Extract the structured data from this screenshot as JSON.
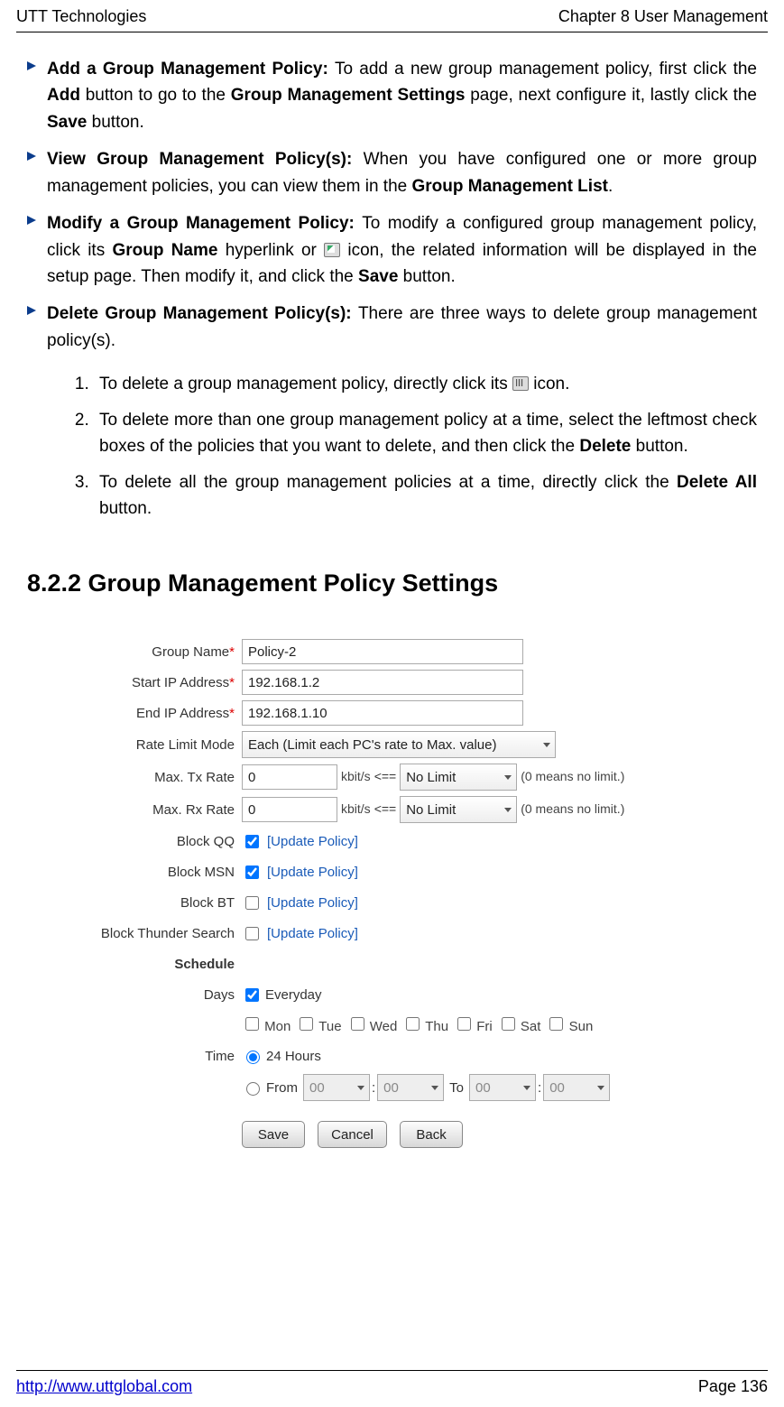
{
  "header": {
    "left": "UTT Technologies",
    "right": "Chapter 8 User Management"
  },
  "footer": {
    "url": "http://www.uttglobal.com",
    "page": "Page 136"
  },
  "bullets": [
    {
      "title": "Add a Group Management Policy: ",
      "text1": "To add a new group management policy, first click the ",
      "b1": "Add",
      "text2": " button to go to the ",
      "b2": "Group Management Settings",
      "text3": " page, next configure it, lastly click the ",
      "b3": "Save",
      "text4": " button."
    },
    {
      "title": "View Group Management Policy(s): ",
      "text1": "When you have configured one or more group management policies, you can view them in the ",
      "b1": "Group Management List",
      "text2": "."
    },
    {
      "title": "Modify a Group Management Policy: ",
      "text1": "To modify a configured group management policy, click its ",
      "b1": "Group Name",
      "text2": " hyperlink or ",
      "text3": " icon, the related information will be displayed in the setup page. Then modify it, and click the ",
      "b2": "Save",
      "text4": " button."
    },
    {
      "title": "Delete Group Management Policy(s): ",
      "text1": "There are three ways to delete group management policy(s)."
    }
  ],
  "numbered": {
    "n1a": "To delete a group management policy, directly click its ",
    "n1b": " icon.",
    "n2a": "To delete more than one group management policy at a time, select the leftmost check boxes of the policies that you want to delete, and then click the ",
    "n2b": "Delete",
    "n2c": " button.",
    "n3a": "To delete all the group management policies at a time, directly click the ",
    "n3b": "Delete All",
    "n3c": " button."
  },
  "section_heading": "8.2.2   Group Management Policy Settings",
  "form": {
    "labels": {
      "group_name": "Group Name",
      "start_ip": "Start IP Address",
      "end_ip": "End IP Address",
      "rate_mode": "Rate Limit Mode",
      "max_tx": "Max. Tx Rate",
      "max_rx": "Max. Rx Rate",
      "block_qq": "Block QQ",
      "block_msn": "Block MSN",
      "block_bt": "Block BT",
      "block_thunder": "Block Thunder Search",
      "schedule": "Schedule",
      "days": "Days",
      "time": "Time"
    },
    "values": {
      "group_name": "Policy-2",
      "start_ip": "192.168.1.2",
      "end_ip": "192.168.1.10",
      "rate_mode": "Each (Limit each PC's rate to Max. value)",
      "max_tx": "0",
      "max_rx": "0",
      "kbit": "kbit/s",
      "arrow": "<==",
      "no_limit": "No Limit",
      "note_zero": "(0 means no limit.)",
      "update": "[Update Policy]",
      "everyday": "Everyday",
      "mon": "Mon",
      "tue": "Tue",
      "wed": "Wed",
      "thu": "Thu",
      "fri": "Fri",
      "sat": "Sat",
      "sun": "Sun",
      "twenty_four": "24 Hours",
      "from": "From",
      "to": "To",
      "zero": "00"
    },
    "buttons": {
      "save": "Save",
      "cancel": "Cancel",
      "back": "Back"
    }
  }
}
